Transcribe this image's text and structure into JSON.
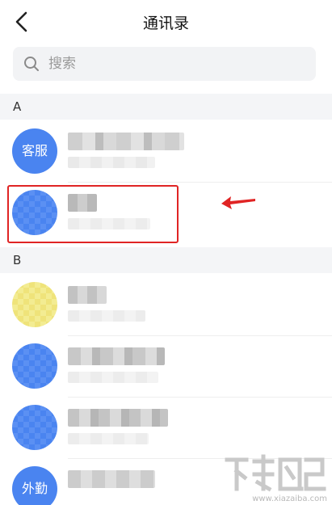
{
  "header": {
    "title": "通讯录"
  },
  "search": {
    "placeholder": "搜索"
  },
  "sections": [
    {
      "letter": "A",
      "contacts": [
        {
          "avatar_text": "客服",
          "avatar_color": "#4a84f0"
        },
        {
          "avatar_text": "",
          "avatar_color": "#4a84f0",
          "highlighted": true
        }
      ]
    },
    {
      "letter": "B",
      "contacts": [
        {
          "avatar_text": "",
          "avatar_color": "#f3ec92"
        },
        {
          "avatar_text": "",
          "avatar_color": "#4a84f0"
        },
        {
          "avatar_text": "",
          "avatar_color": "#4a84f0"
        },
        {
          "avatar_text": "外勤",
          "avatar_color": "#4a84f0"
        }
      ]
    }
  ],
  "annotation": {
    "highlight_color": "#e02424"
  },
  "watermark": {
    "text": "www.xiazaiba.com"
  },
  "icons": {
    "back": "chevron-left-icon",
    "search": "search-icon"
  }
}
